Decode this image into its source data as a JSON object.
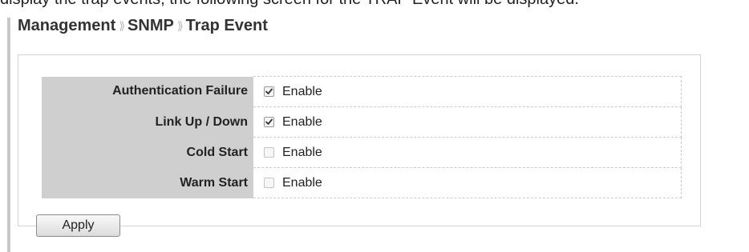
{
  "clipped_text": "display the trap events, the following screen for the TRAP Event will be displayed.",
  "breadcrumb": {
    "items": [
      "Management",
      "SNMP",
      "Trap Event"
    ],
    "separator": "⟫"
  },
  "trap_events": [
    {
      "label": "Authentication Failure",
      "option_label": "Enable",
      "checked": true
    },
    {
      "label": "Link Up / Down",
      "option_label": "Enable",
      "checked": true
    },
    {
      "label": "Cold Start",
      "option_label": "Enable",
      "checked": false
    },
    {
      "label": "Warm Start",
      "option_label": "Enable",
      "checked": false
    }
  ],
  "actions": {
    "apply_label": "Apply"
  },
  "colors": {
    "label_background": "#cfcfcf",
    "dashed_border": "#c9c9d9",
    "left_rule": "#c8c8c8"
  }
}
